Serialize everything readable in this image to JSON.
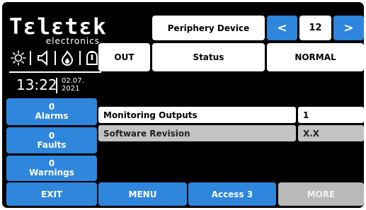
{
  "brand": {
    "name": "Tεlεtεk",
    "subtitle": "electronics"
  },
  "icons": [
    "brightness-icon",
    "speaker-icon",
    "fire-icon",
    "output-bell-icon"
  ],
  "clock": {
    "time": "13:22",
    "date_top": "02.07.",
    "date_bottom": "2021"
  },
  "counters": {
    "alarms": {
      "count": "0",
      "label": "Alarms"
    },
    "faults": {
      "count": "0",
      "label": "Faults"
    },
    "warnings": {
      "count": "0",
      "label": "Warnings"
    }
  },
  "header": {
    "title": "Periphery Device",
    "prev_glyph": "<",
    "device_number": "12",
    "next_glyph": ">",
    "device_type": "OUT",
    "status_label": "Status",
    "status_value": "NORMAL"
  },
  "properties": [
    {
      "label": "Monitoring Outputs",
      "value": "1"
    },
    {
      "label": "Software Revision",
      "value": "X.X"
    }
  ],
  "footer": {
    "exit": "EXIT",
    "menu": "MENU",
    "access": "Access 3",
    "more": "MORE"
  },
  "colors": {
    "button_blue": "#2f86dd",
    "disabled_grey": "#b9b9b9",
    "background": "#000000"
  }
}
